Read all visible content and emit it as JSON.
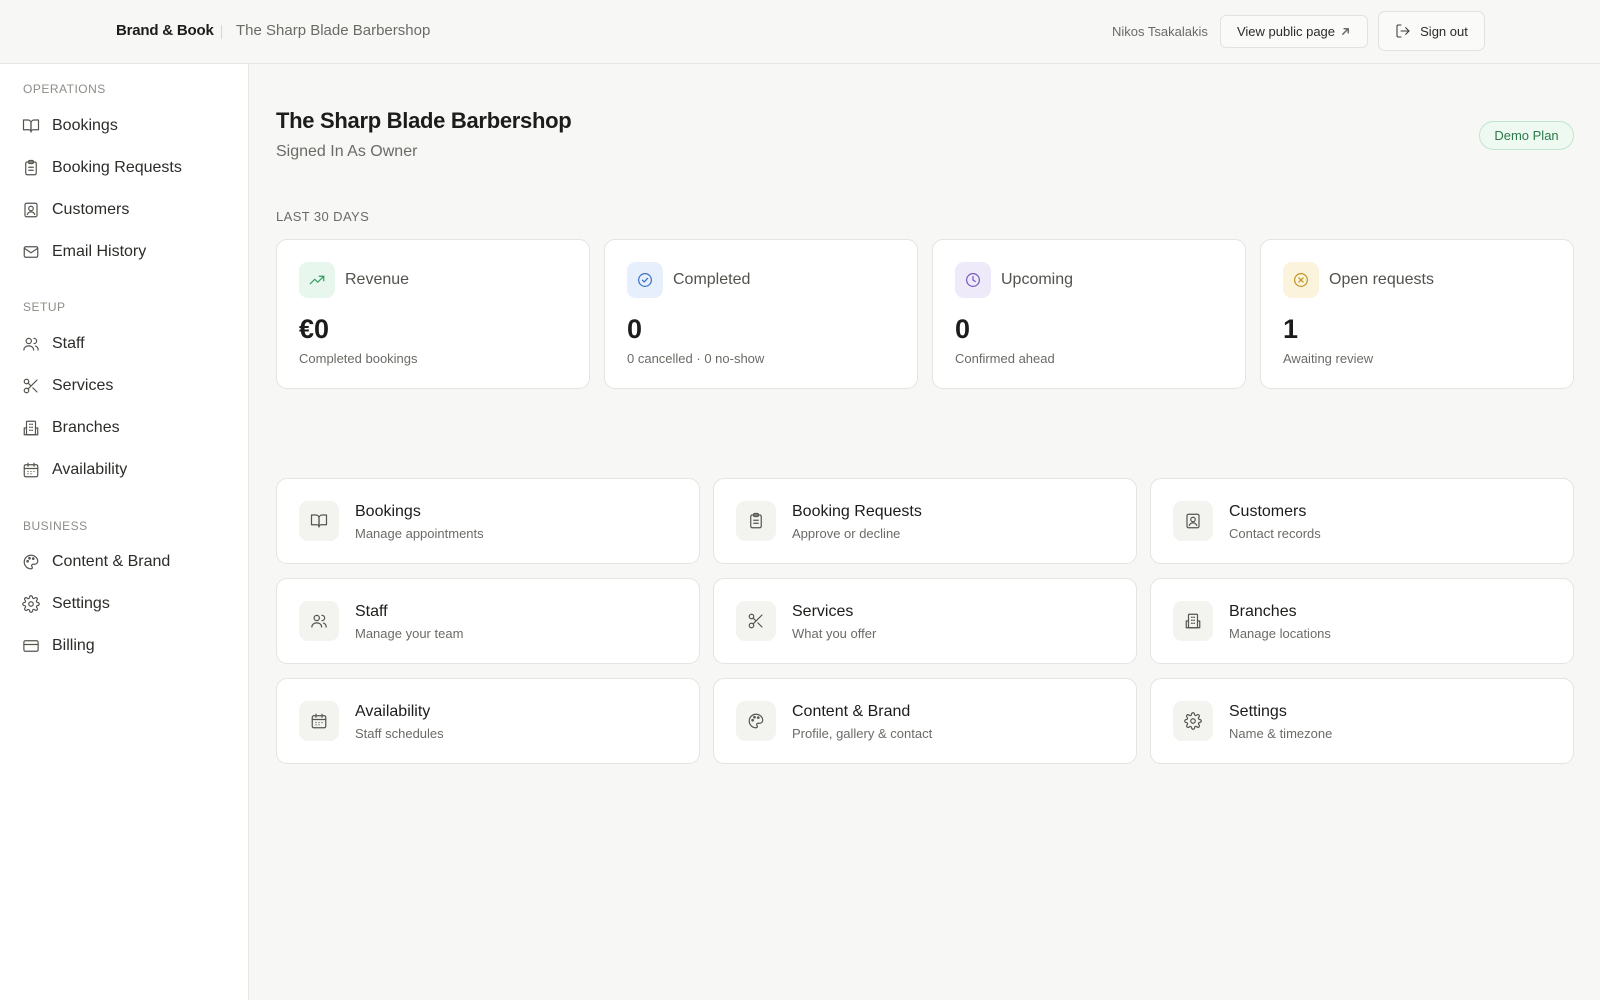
{
  "header": {
    "brand": "Brand & Book",
    "business_name": "The Sharp Blade Barbershop",
    "user_name": "Nikos Tsakalakis",
    "view_public_label": "View public page",
    "sign_out_label": "Sign out"
  },
  "sidebar": {
    "sections": [
      {
        "title": "OPERATIONS",
        "items": [
          {
            "label": "Bookings",
            "icon": "book-icon"
          },
          {
            "label": "Booking Requests",
            "icon": "clipboard-icon"
          },
          {
            "label": "Customers",
            "icon": "contact-icon"
          },
          {
            "label": "Email History",
            "icon": "mail-icon"
          }
        ]
      },
      {
        "title": "SETUP",
        "items": [
          {
            "label": "Staff",
            "icon": "users-icon"
          },
          {
            "label": "Services",
            "icon": "scissors-icon"
          },
          {
            "label": "Branches",
            "icon": "building-icon"
          },
          {
            "label": "Availability",
            "icon": "calendar-icon"
          }
        ]
      },
      {
        "title": "BUSINESS",
        "items": [
          {
            "label": "Content & Brand",
            "icon": "palette-icon"
          },
          {
            "label": "Settings",
            "icon": "gear-icon"
          },
          {
            "label": "Billing",
            "icon": "credit-card-icon"
          }
        ]
      }
    ]
  },
  "main": {
    "title": "The Sharp Blade Barbershop",
    "subtitle": "Signed In As Owner",
    "plan_badge": "Demo Plan",
    "period_label": "LAST 30 DAYS",
    "stats": [
      {
        "label": "Revenue",
        "value": "€0",
        "caption": "Completed bookings",
        "icon": "trending-up-icon",
        "color": "#e8f7ee"
      },
      {
        "label": "Completed",
        "value": "0",
        "caption": "0 cancelled · 0 no-show",
        "icon": "check-circle-icon",
        "color": "#e6effb"
      },
      {
        "label": "Upcoming",
        "value": "0",
        "caption": "Confirmed ahead",
        "icon": "clock-icon",
        "color": "#efeafa"
      },
      {
        "label": "Open requests",
        "value": "1",
        "caption": "Awaiting review",
        "icon": "x-circle-icon",
        "color": "#fbf3dc"
      }
    ],
    "links": [
      {
        "title": "Bookings",
        "desc": "Manage appointments",
        "icon": "book-icon"
      },
      {
        "title": "Booking Requests",
        "desc": "Approve or decline",
        "icon": "clipboard-icon"
      },
      {
        "title": "Customers",
        "desc": "Contact records",
        "icon": "contact-icon"
      },
      {
        "title": "Staff",
        "desc": "Manage your team",
        "icon": "users-icon"
      },
      {
        "title": "Services",
        "desc": "What you offer",
        "icon": "scissors-icon"
      },
      {
        "title": "Branches",
        "desc": "Manage locations",
        "icon": "building-icon"
      },
      {
        "title": "Availability",
        "desc": "Staff schedules",
        "icon": "calendar-icon"
      },
      {
        "title": "Content & Brand",
        "desc": "Profile, gallery & contact",
        "icon": "palette-icon"
      },
      {
        "title": "Settings",
        "desc": "Name & timezone",
        "icon": "gear-icon"
      }
    ]
  }
}
